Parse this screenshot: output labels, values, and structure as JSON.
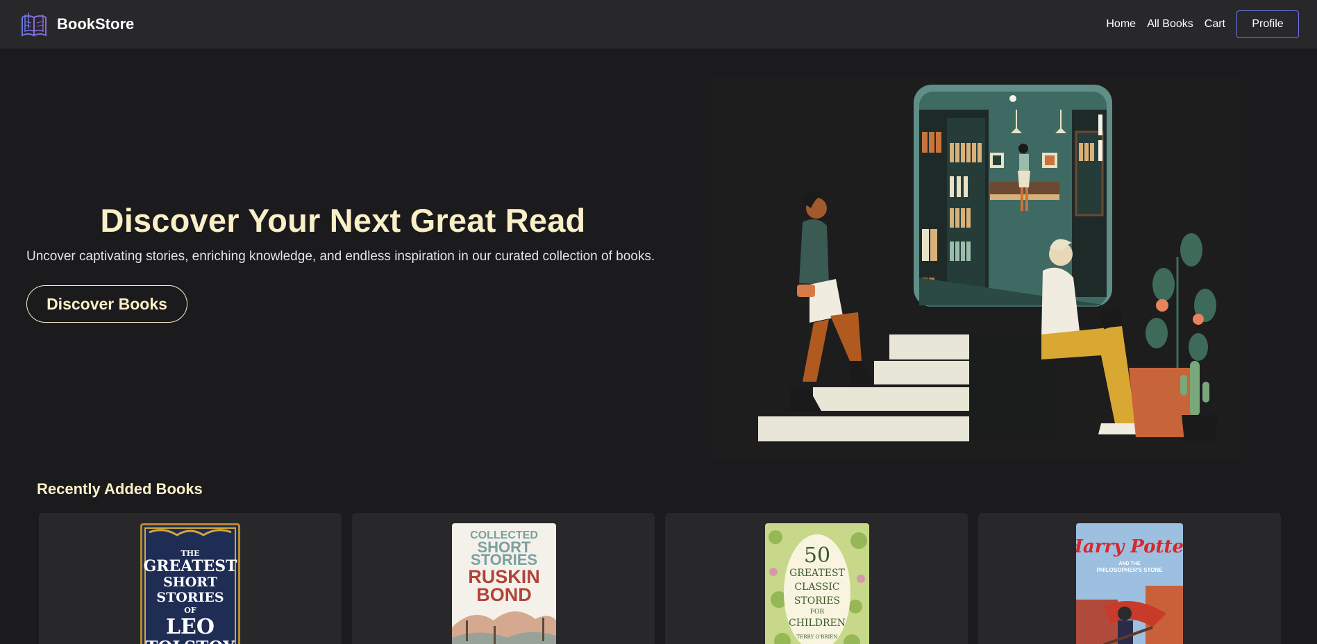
{
  "brand": {
    "name": "BookStore",
    "logo_icon": "open-book-icon"
  },
  "nav": {
    "home": "Home",
    "all_books": "All Books",
    "cart": "Cart",
    "profile": "Profile"
  },
  "hero": {
    "title": "Discover Your Next Great Read",
    "subtitle": "Uncover captivating stories, enriching knowledge, and endless inspiration in our curated collection of books.",
    "cta": "Discover Books"
  },
  "recent": {
    "heading": "Recently Added Books",
    "books": [
      {
        "cover_line1": "THE",
        "cover_line2": "GREATEST",
        "cover_line3": "SHORT",
        "cover_line4": "STORIES",
        "cover_line5": "OF",
        "cover_line6": "LEO",
        "cover_line7": "TOLSTOY"
      },
      {
        "cover_line1": "COLLECTED",
        "cover_line2": "SHORT",
        "cover_line3": "STORIES",
        "cover_line4": "RUSKIN",
        "cover_line5": "BOND"
      },
      {
        "cover_line1": "50",
        "cover_line2": "GREATEST",
        "cover_line3": "CLASSIC",
        "cover_line4": "STORIES",
        "cover_line5": "FOR",
        "cover_line6": "CHILDREN",
        "cover_line7": "TERRY O'BRIEN"
      },
      {
        "cover_line1": "Harry Potter",
        "cover_line2": "AND THE",
        "cover_line3": "PHILOSOPHER'S STONE"
      }
    ]
  },
  "colors": {
    "background": "#1b1a1c",
    "navbar": "#28272a",
    "accent_cream": "#fbefc7",
    "profile_border": "#6a78e8",
    "card": "#28272a"
  }
}
